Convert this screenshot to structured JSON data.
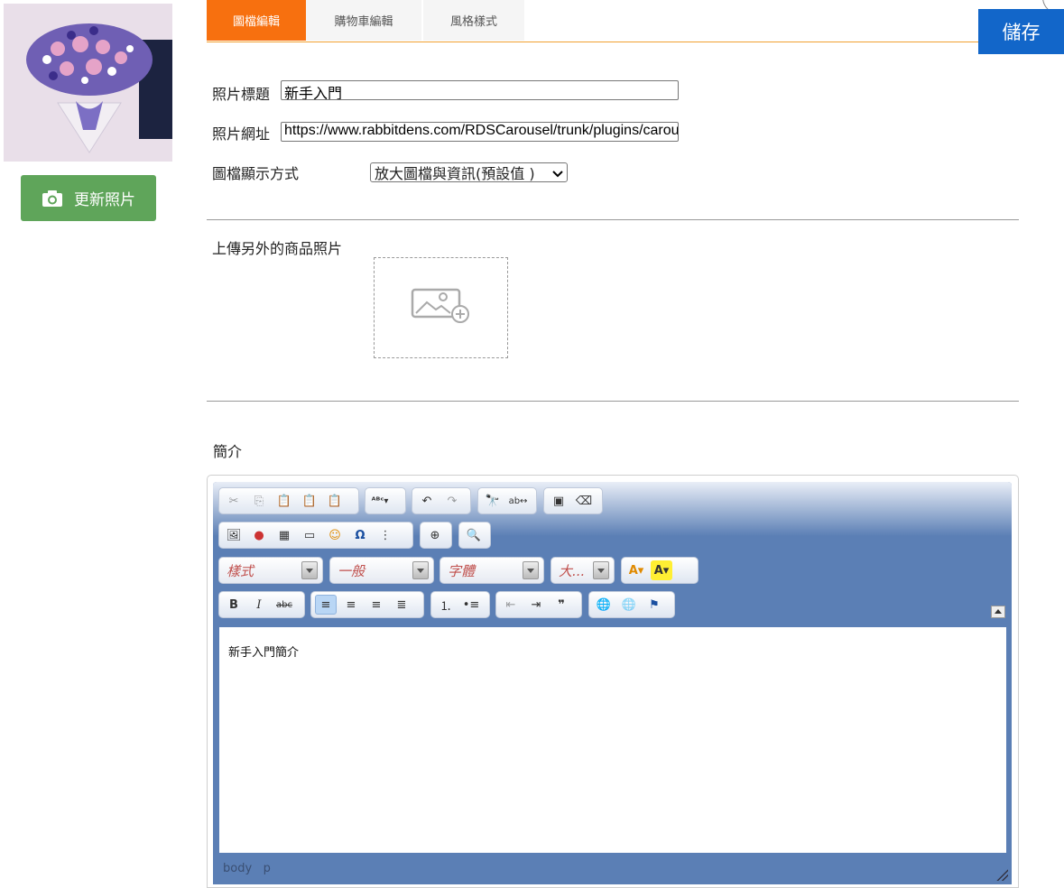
{
  "tabs": [
    {
      "label": "圖檔編輯",
      "active": true
    },
    {
      "label": "購物車編輯",
      "active": false
    },
    {
      "label": "風格樣式",
      "active": false
    }
  ],
  "save_label": "儲存",
  "update_photo_label": "更新照片",
  "form": {
    "title_label": "照片標題",
    "title_value": "新手入門",
    "url_label": "照片網址",
    "url_value": "https://www.rabbitdens.com/RDSCarousel/trunk/plugins/carousel",
    "display_label": "圖檔顯示方式",
    "display_value": "放大圖檔與資訊(預設值 )"
  },
  "upload_label": "上傳另外的商品照片",
  "intro_label": "簡介",
  "editor": {
    "style_combo": "樣式",
    "format_combo": "一般",
    "font_combo": "字體",
    "size_combo": "大...",
    "content": "新手入門簡介",
    "path_body": "body",
    "path_p": "p"
  },
  "colors": {
    "active_tab": "#f7700f",
    "save": "#1266c9",
    "update_btn": "#5fa55a",
    "editor_bg": "#5b7fb5"
  }
}
